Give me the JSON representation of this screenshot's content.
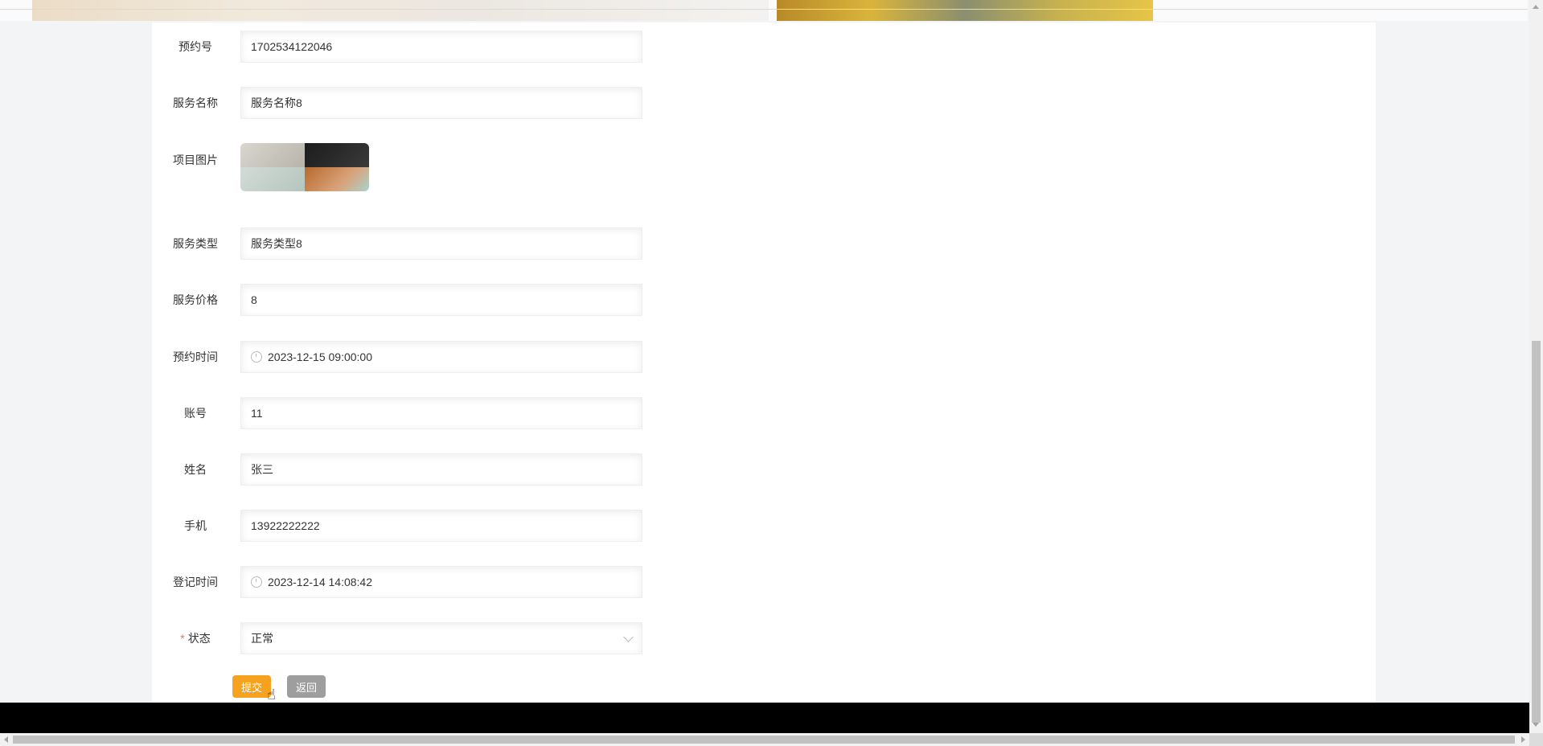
{
  "form": {
    "fields": [
      {
        "label": "预约号",
        "value": "1702534122046"
      },
      {
        "label": "服务名称",
        "value": "服务名称8"
      },
      {
        "label": "项目图片",
        "value": ""
      },
      {
        "label": "服务类型",
        "value": "服务类型8"
      },
      {
        "label": "服务价格",
        "value": "8"
      },
      {
        "label": "预约时间",
        "value": "2023-12-15 09:00:00"
      },
      {
        "label": "账号",
        "value": "11"
      },
      {
        "label": "姓名",
        "value": "张三"
      },
      {
        "label": "手机",
        "value": "13922222222"
      },
      {
        "label": "登记时间",
        "value": "2023-12-14 14:08:42"
      },
      {
        "label": "状态",
        "value": "正常",
        "required_mark": "*"
      }
    ],
    "submit_label": "提交",
    "back_label": "返回"
  },
  "colors": {
    "submit": "#f7a21e",
    "back": "#9e9e9e",
    "required": "#f56c6c",
    "footer": "#000000"
  }
}
